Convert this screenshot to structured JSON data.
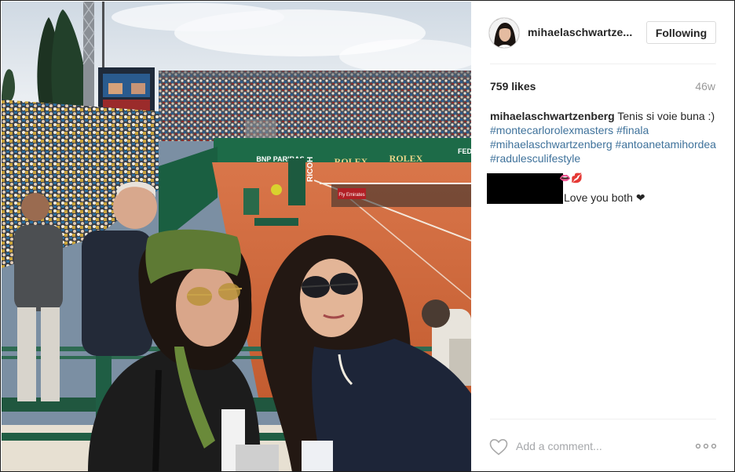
{
  "post": {
    "username": "mihaelaschwartze...",
    "follow_label": "Following",
    "likes": "759 likes",
    "age": "46w",
    "caption": {
      "author": "mihaelaschwartzenberg",
      "text": "Tenis si voie buna :)",
      "hashtags": [
        "#montecarlorolexmasters",
        "#finala",
        "#mihaelaschwartzenberg",
        "#antoanetamihordea",
        "#radulesculifestyle"
      ]
    },
    "comment": {
      "emoji": "👄💋",
      "text": "Love you both ❤"
    },
    "add_comment_placeholder": "Add a comment...",
    "more_icon": "more-options-icon",
    "like_icon": "heart-outline-icon"
  },
  "photo": {
    "signs": [
      "ROLEX",
      "ROLEX",
      "BNP PARIBAS",
      "RICOH",
      "FED",
      "Fly Emirates"
    ],
    "colors": {
      "clay": "#c8693a",
      "sky": "#e9eef3",
      "green": "#1c6a4a"
    }
  },
  "colors": {
    "hashtag": "#3f729b",
    "muted": "#999999",
    "text": "#262626"
  }
}
